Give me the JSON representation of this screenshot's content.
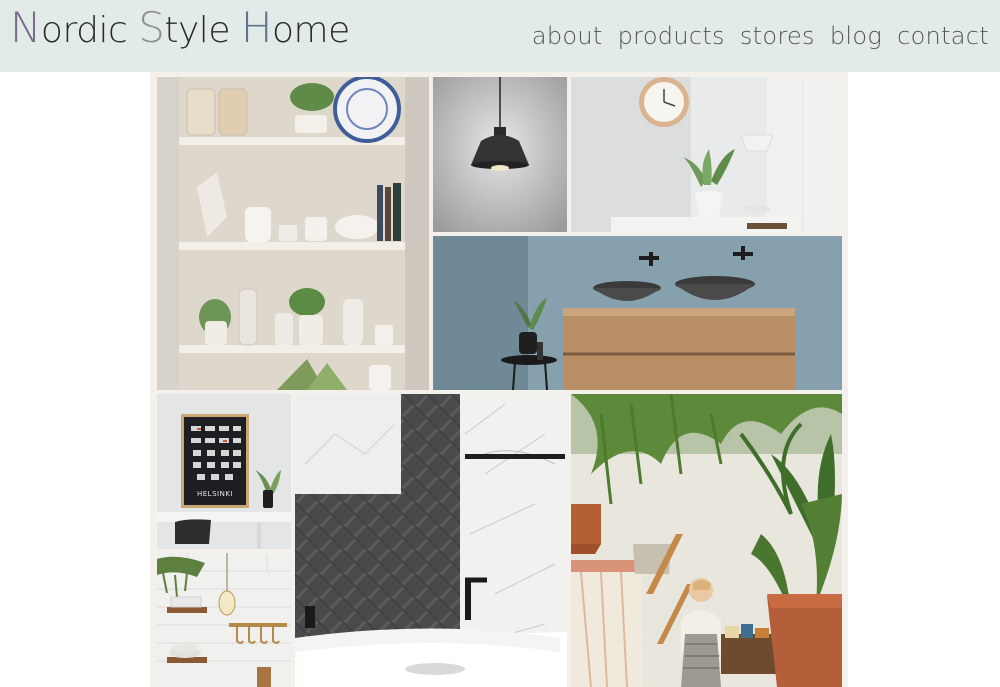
{
  "site": {
    "logo": {
      "word1_cap": "N",
      "word1_rest": "ordic ",
      "word2_cap": "S",
      "word2_rest": "tyle ",
      "word3_cap": "H",
      "word3_rest": "ome"
    },
    "colors": {
      "header_bg": "#e3ebe8",
      "logo_n": "#7b6c8c",
      "logo_s": "#8a8f94",
      "logo_h": "#5f7489",
      "nav_text": "#555555"
    }
  },
  "nav": {
    "items": [
      {
        "label": "about"
      },
      {
        "label": "products"
      },
      {
        "label": "stores"
      },
      {
        "label": "blog"
      },
      {
        "label": "contact"
      }
    ]
  },
  "gallery": {
    "tiles": [
      {
        "name": "kitchen-shelves-photo"
      },
      {
        "name": "pendant-lamp-photo"
      },
      {
        "name": "wall-clock-desk-photo"
      },
      {
        "name": "bathroom-vanity-photo"
      },
      {
        "name": "helsinki-poster-photo"
      },
      {
        "name": "kitchen-hooks-photo"
      },
      {
        "name": "herringbone-bath-photo"
      },
      {
        "name": "plants-child-photo"
      }
    ],
    "poster_caption": "HELSINKI"
  }
}
